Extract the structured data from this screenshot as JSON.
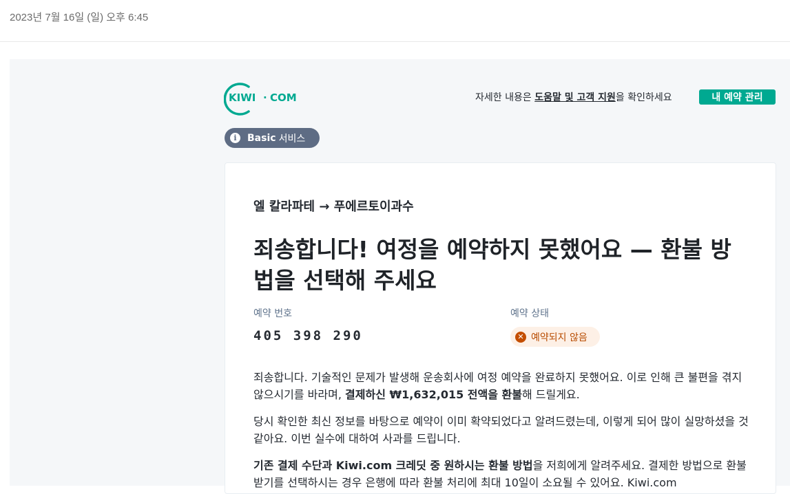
{
  "header": {
    "timestamp": "2023년 7월 16일 (일) 오후 6:45"
  },
  "brand": {
    "name": "KIWI · COM",
    "primary": "KIWI",
    "dot": "·",
    "secondary": "COM",
    "color": "#00a991"
  },
  "help": {
    "prefix": "자세한 내용은 ",
    "link": "도움말 및 고객 지원",
    "suffix": "을 확인하세요"
  },
  "manage_button": "내 예약 관리",
  "service_badge": {
    "icon": "info-icon",
    "bold": "Basic",
    "label": "서비스"
  },
  "route": {
    "from": "엘 칼라파테",
    "arrow": "→",
    "to": "푸에르토이과수"
  },
  "headline": "죄송합니다! 여정을 예약하지 못했어요 — 환불 방법을 선택해 주세요",
  "booking": {
    "number_label": "예약 번호",
    "number": "405 398 290",
    "status_label": "예약 상태",
    "status": "예약되지 않음",
    "status_icon": "x-circle-icon",
    "status_color": "#c44e00"
  },
  "paragraphs": {
    "p1_a": "죄송합니다. 기술적인 문제가 발생해 운송회사에 여정 예약을 완료하지 못했어요. 이로 인해 큰 불편을 겪지 않으시기를 바라며, ",
    "p1_bold": "결제하신 ₩1,632,015 전액을 환불",
    "p1_b": "해 드릴게요.",
    "p2": "당시 확인한 최신 정보를 바탕으로 예약이 이미 확약되었다고 알려드렸는데, 이렇게 되어 많이 실망하셨을 것 같아요. 이번 실수에 대하여 사과를 드립니다.",
    "p3_bold": "기존 결제 수단과 Kiwi.com 크레딧 중 원하시는 환불 방법",
    "p3_a": "을 저희에게 알려주세요. 결제한 방법으로 환불받기를 선택하시는 경우 은행에 따라 환불 처리에 최대 10일이 소요될 수 있어요. Kiwi.com"
  }
}
